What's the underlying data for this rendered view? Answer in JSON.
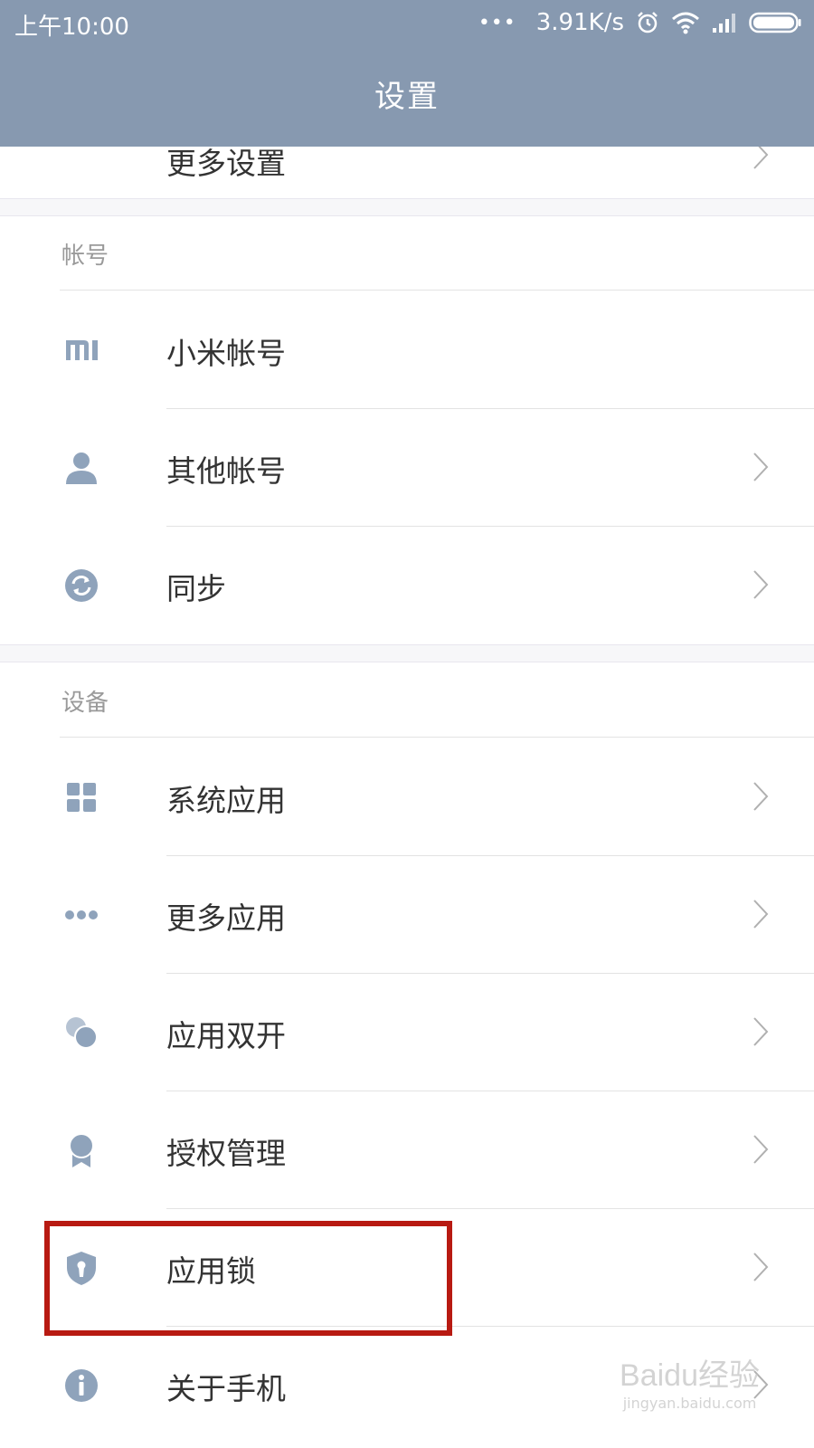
{
  "status_bar": {
    "time": "上午10:00",
    "net_speed": "3.91K/s",
    "dots": "•••"
  },
  "app_bar": {
    "title": "设置"
  },
  "partial_item": {
    "label": "更多设置"
  },
  "sections": {
    "account": {
      "label": "帐号",
      "items": [
        {
          "label": "小米帐号",
          "icon": "mi-icon"
        },
        {
          "label": "其他帐号",
          "icon": "person-icon"
        },
        {
          "label": "同步",
          "icon": "sync-icon"
        }
      ]
    },
    "device": {
      "label": "设备",
      "items": [
        {
          "label": "系统应用",
          "icon": "grid-icon"
        },
        {
          "label": "更多应用",
          "icon": "more-dots-icon"
        },
        {
          "label": "应用双开",
          "icon": "dual-apps-icon"
        },
        {
          "label": "授权管理",
          "icon": "badge-icon"
        },
        {
          "label": "应用锁",
          "icon": "shield-lock-icon"
        },
        {
          "label": "关于手机",
          "icon": "info-icon"
        }
      ]
    }
  },
  "watermark": {
    "main": "Baidu经验",
    "sub": "jingyan.baidu.com"
  },
  "colors": {
    "header": "#8799b0",
    "icon": "#8fa3bb",
    "highlight": "#b81a12"
  }
}
